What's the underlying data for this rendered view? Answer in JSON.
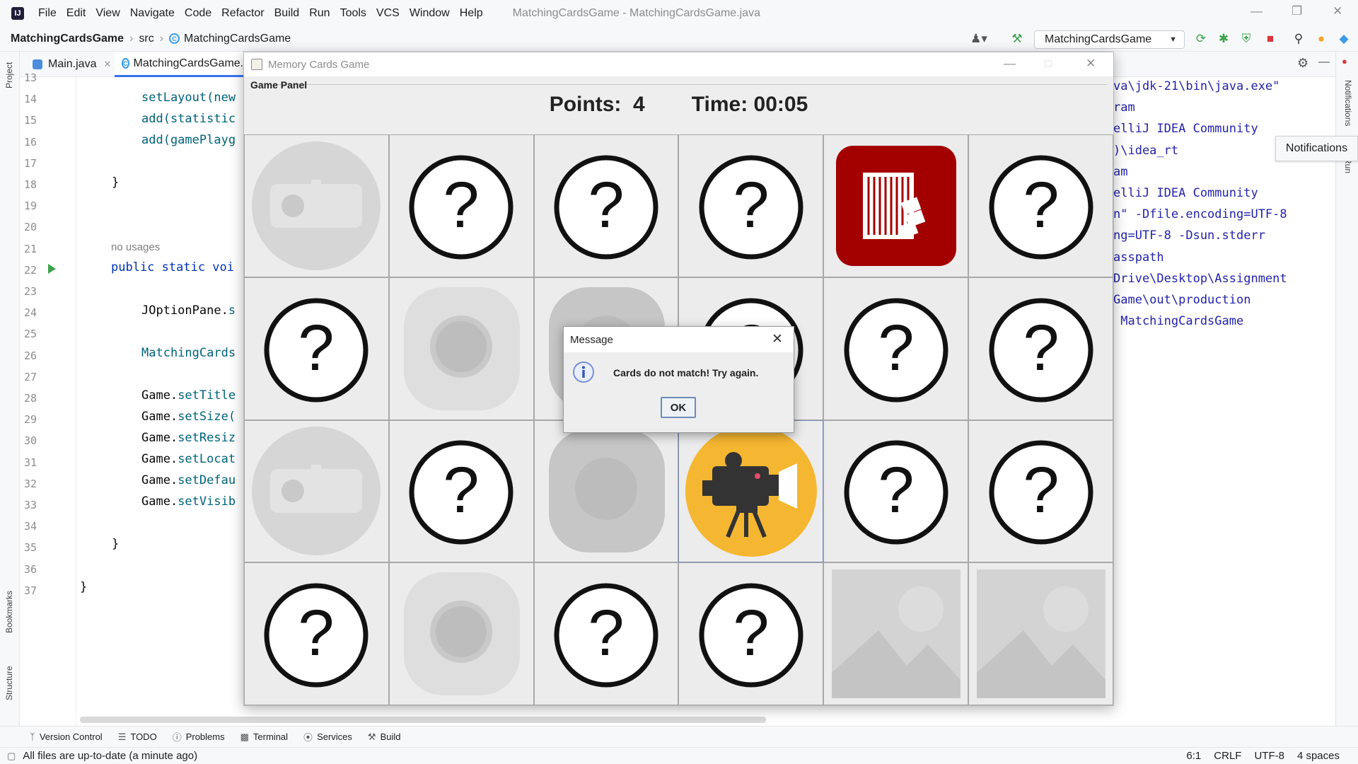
{
  "menubar": {
    "items": [
      "File",
      "Edit",
      "View",
      "Navigate",
      "Code",
      "Refactor",
      "Build",
      "Run",
      "Tools",
      "VCS",
      "Window",
      "Help"
    ],
    "window_title": "MatchingCardsGame - MatchingCardsGame.java"
  },
  "navbar": {
    "project": "MatchingCardsGame",
    "folder": "src",
    "file": "MatchingCardsGame",
    "run_config": "MatchingCardsGame"
  },
  "left_stripe": {
    "project": "Project",
    "bookmarks": "Bookmarks",
    "structure": "Structure"
  },
  "right_stripe": {
    "notifications": "Notifications",
    "run": "Run"
  },
  "editor_tabs": [
    {
      "label": "Main.java"
    },
    {
      "label": "MatchingCardsGame.j"
    }
  ],
  "code": {
    "line_numbers": [
      "13",
      "14",
      "15",
      "16",
      "17",
      "18",
      "19",
      "20",
      "21",
      "22",
      "23",
      "24",
      "25",
      "26",
      "27",
      "28",
      "29",
      "30",
      "31",
      "32",
      "33",
      "34",
      "35",
      "36",
      "37"
    ],
    "l14": "setLayout(new",
    "l15": "add(statistic",
    "l16": "add(gamePlayg",
    "l18": "}",
    "hint": "no usages",
    "l21_kw": "public static voi",
    "l23_cls": "JOptionPane.",
    "l23_m": "s",
    "l25": "MatchingCards",
    "l27_m": "setTitle",
    "l28_m": "setSize(",
    "l29_m": "setResiz",
    "l30_m": "setLocat",
    "l31_m": "setDefau",
    "l32_m": "setVisib",
    "game_obj": "Game.",
    "l34": "}",
    "l36": "}"
  },
  "console": [
    "va\\jdk-21\\bin\\java.exe\"",
    "ram",
    "elliJ IDEA Community",
    ")\\idea_rt",
    "am",
    "elliJ IDEA Community",
    "n\" -Dfile.encoding=UTF-8",
    "ng=UTF-8 -Dsun.stderr",
    "asspath",
    "Drive\\Desktop\\Assignment",
    "Game\\out\\production",
    " MatchingCardsGame"
  ],
  "notifications_tooltip": "Notifications",
  "bottom_tools": [
    "Version Control",
    "TODO",
    "Problems",
    "Terminal",
    "Services",
    "Build"
  ],
  "status": {
    "message": "All files are up-to-date (a minute ago)",
    "position": "6:1",
    "line_sep": "CRLF",
    "encoding": "UTF-8",
    "indent": "4 spaces"
  },
  "game": {
    "title": "Memory Cards Game",
    "panel_label": "Game Panel",
    "points_label": "Points:",
    "points": "4",
    "time_label": "Time:",
    "time": "00:05",
    "question_mark": "?",
    "cards": [
      "matched-camera",
      "hidden",
      "hidden",
      "hidden",
      "revealed-film",
      "hidden",
      "hidden",
      "matched-button",
      "matched-button-dark",
      "hidden",
      "hidden",
      "hidden",
      "matched-camera",
      "hidden",
      "matched-button-dark",
      "revealed-video-camera",
      "hidden",
      "hidden",
      "hidden",
      "matched-button",
      "hidden",
      "hidden",
      "matched-image",
      "matched-image"
    ],
    "colors": {
      "film": "#a30000",
      "video": "#f5b731",
      "faded": "#d6d6d6"
    }
  },
  "dialog": {
    "title": "Message",
    "text": "Cards do not match! Try again.",
    "ok": "OK"
  }
}
